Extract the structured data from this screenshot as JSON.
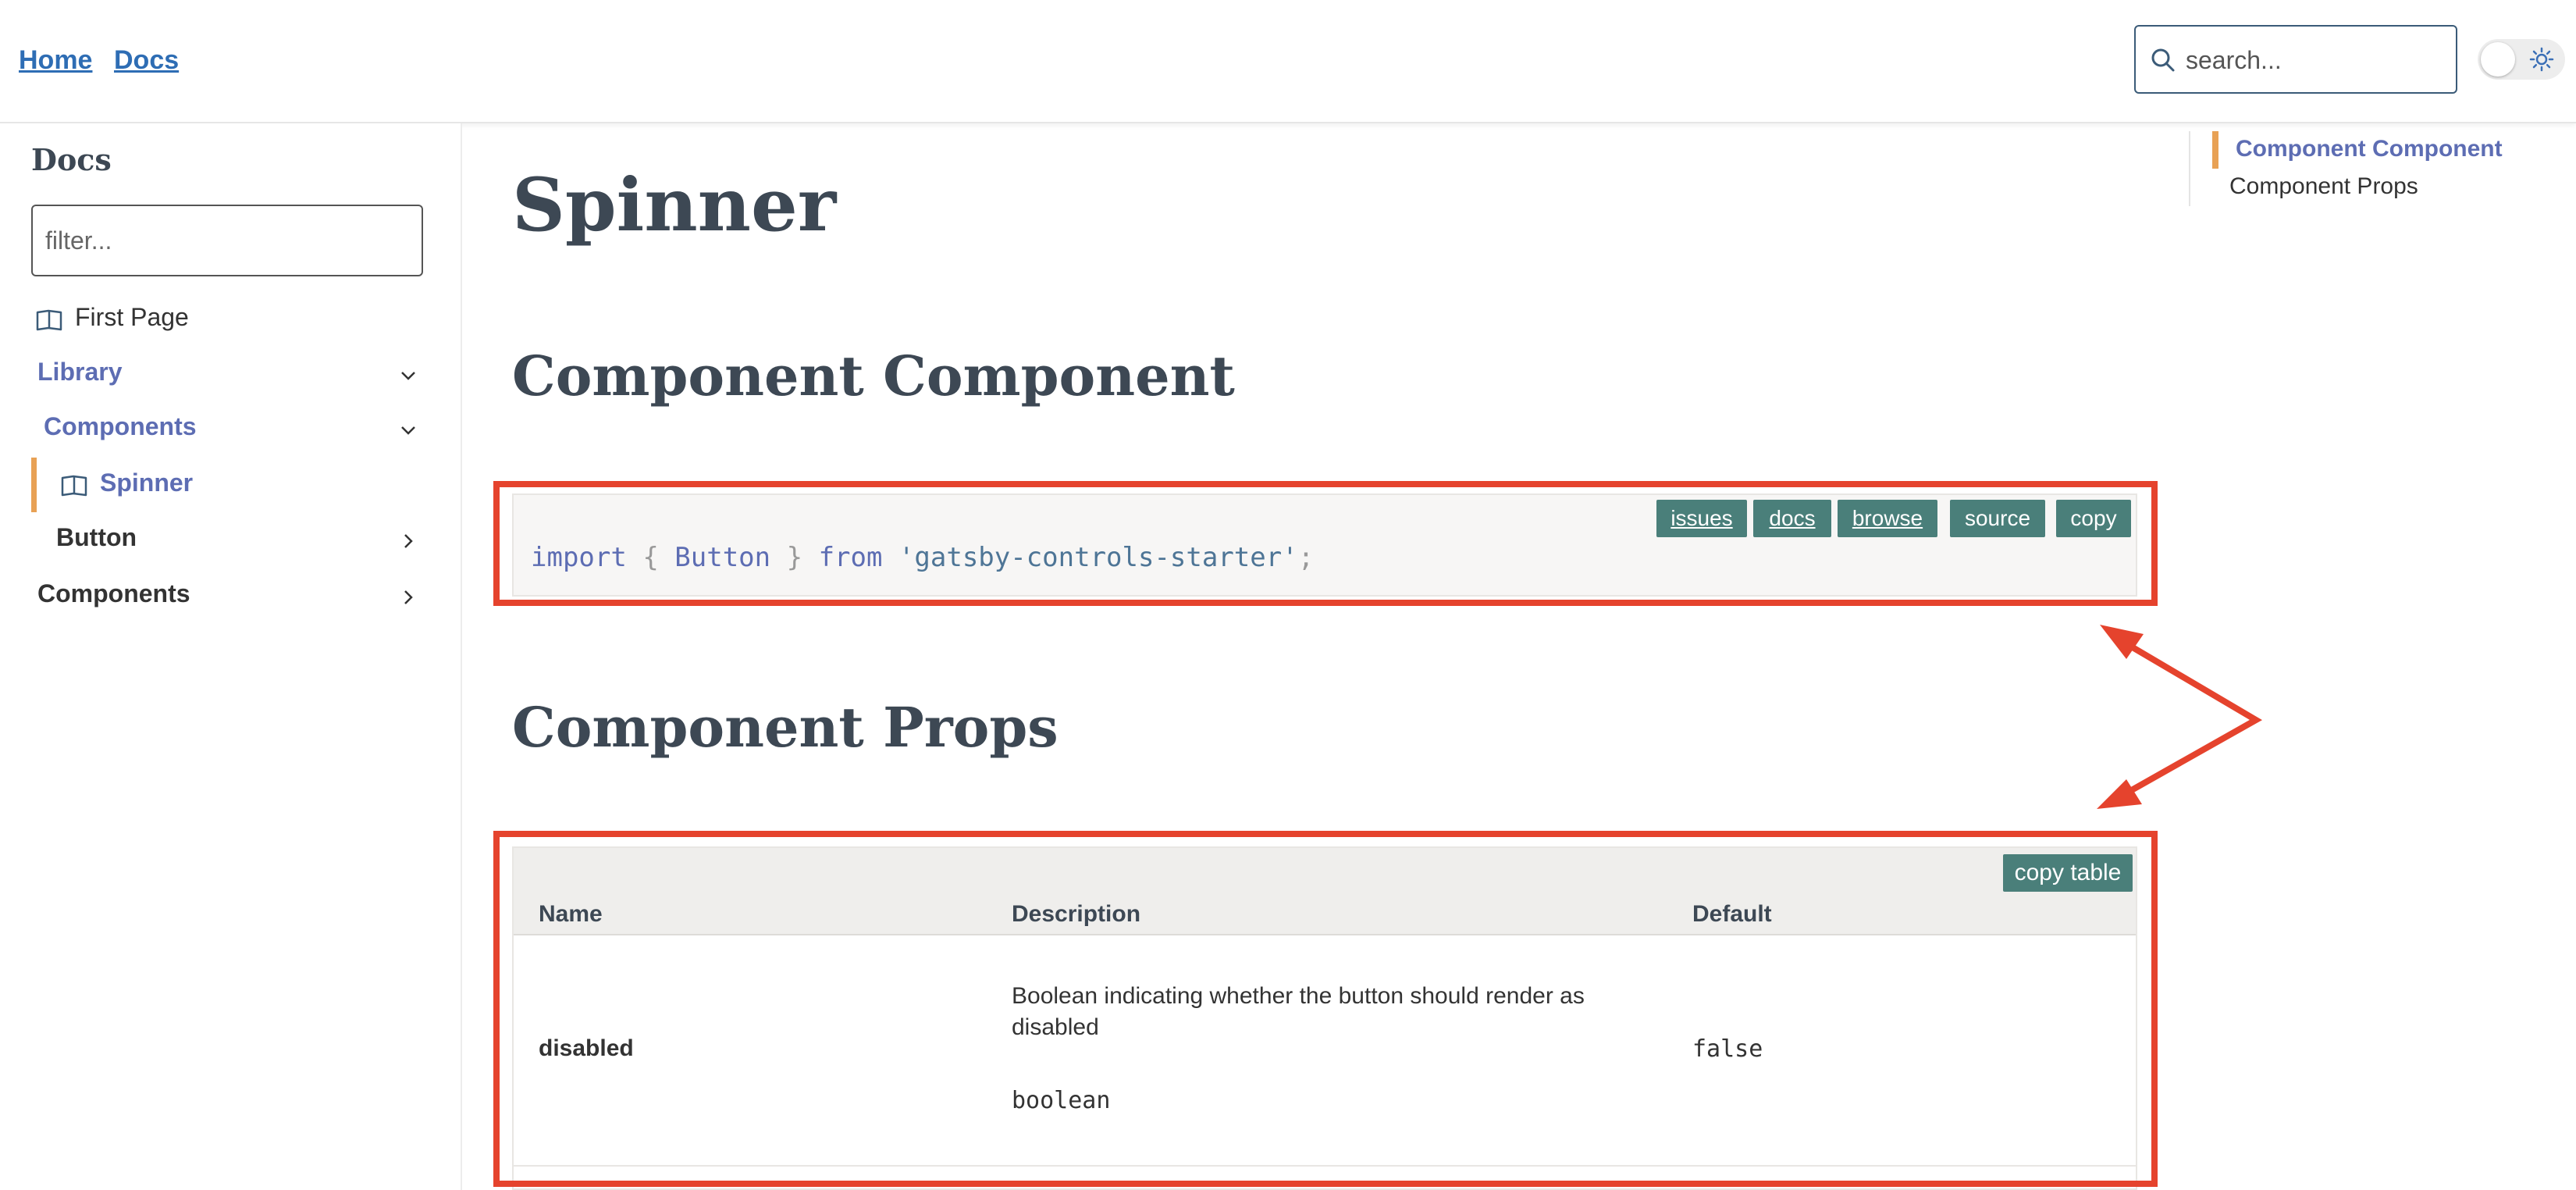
{
  "header": {
    "nav": [
      {
        "label": "Home"
      },
      {
        "label": "Docs"
      }
    ],
    "search": {
      "placeholder": "search...",
      "icon": "search-icon"
    },
    "theme_toggle": {
      "icon": "sun-icon"
    }
  },
  "sidebar": {
    "title": "Docs",
    "filter_placeholder": "filter...",
    "items": [
      {
        "label": "First Page",
        "icon": "book-icon"
      },
      {
        "label": "Library",
        "expanded": true
      },
      {
        "label": "Components",
        "expanded": true
      },
      {
        "label": "Spinner",
        "icon": "book-icon",
        "active": true
      },
      {
        "label": "Button",
        "expanded": false
      },
      {
        "label": "Components",
        "expanded": false
      }
    ]
  },
  "main": {
    "title": "Spinner",
    "section1_title": "Component Component",
    "code": {
      "kw_import": "import",
      "brace_open": "{",
      "ident": "Button",
      "brace_close": "}",
      "kw_from": "from",
      "string": "'gatsby-controls-starter'",
      "semi": ";"
    },
    "code_toolbar": [
      "issues",
      "docs",
      "browse",
      "source",
      "copy"
    ],
    "section2_title": "Component Props",
    "props_table": {
      "copy_label": "copy table",
      "headers": [
        "Name",
        "Description",
        "Default"
      ],
      "rows": [
        {
          "name": "disabled",
          "description": "Boolean indicating whether the button should render as disabled",
          "type": "boolean",
          "default": "false"
        }
      ]
    }
  },
  "toc": {
    "items": [
      "Component Component",
      "Component Props"
    ]
  },
  "colors": {
    "accent": "#5d6db3",
    "link": "#2e6db4",
    "active_marker": "#e8a155",
    "button_bg": "#4a7f7a",
    "annotation_red": "#e5432d"
  }
}
